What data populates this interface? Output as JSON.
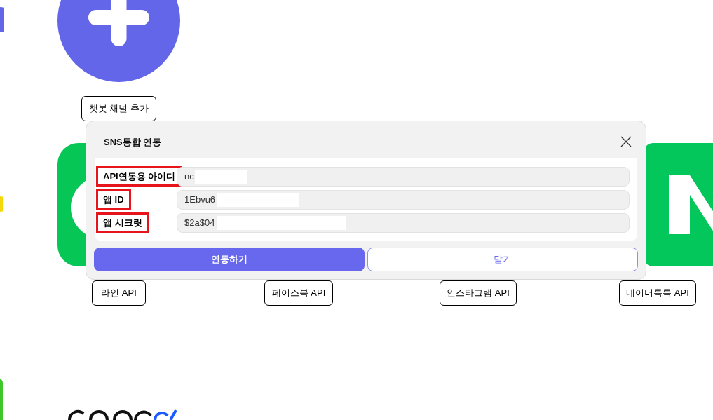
{
  "add_channel": {
    "button": "챗봇 채널 추가"
  },
  "channels": [
    {
      "kind": "line",
      "button": "라인 API"
    },
    {
      "kind": "facebook",
      "button": "페이스북 API"
    },
    {
      "kind": "instagram",
      "button": "인스타그램 API"
    },
    {
      "kind": "naver",
      "button": "네이버톡톡 API"
    }
  ],
  "dialog": {
    "title": "SNS통합 연동",
    "fields": [
      {
        "label": "API연동용 아이디",
        "value": "nc",
        "highlighted": true
      },
      {
        "label": "앱 ID",
        "value": "1Ebvu6",
        "highlighted": true
      },
      {
        "label": "앱 시크릿",
        "value": "$2a$04",
        "highlighted": true
      }
    ],
    "buttons": [
      {
        "kind": "primary",
        "label": "연동하기"
      },
      {
        "kind": "secondary",
        "label": "닫기"
      }
    ]
  }
}
